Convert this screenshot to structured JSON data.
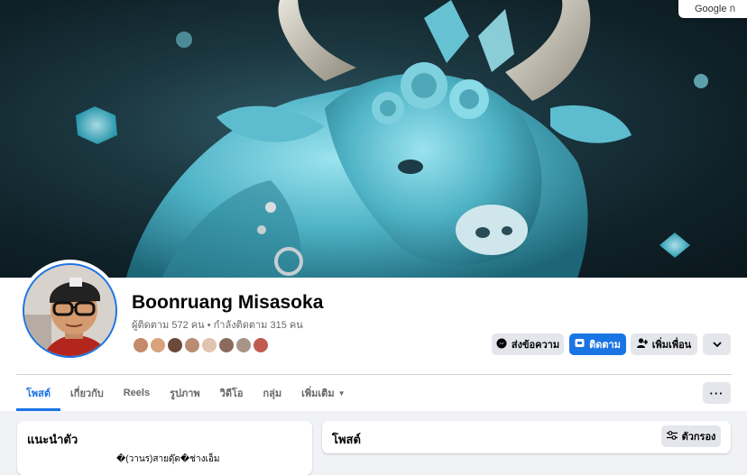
{
  "popup": {
    "text": "Google ก"
  },
  "profile": {
    "name": "Boonruang Misasoka",
    "follow_stats": "ผู้ติดตาม 572 คน • กำลังติดตาม 315 คน"
  },
  "mutual_friend_colors": [
    "#c48a6a",
    "#d9a27c",
    "#6b4a3a",
    "#b98c74",
    "#e2c3b0",
    "#8b6b5c",
    "#a89486",
    "#c25b4f"
  ],
  "actions": {
    "message_label": "ส่งข้อความ",
    "follow_label": "ติดตาม",
    "add_friend_label": "เพิ่มเพื่อน"
  },
  "tabs": [
    {
      "label": "โพสต์",
      "active": true
    },
    {
      "label": "เกี่ยวกับ",
      "active": false
    },
    {
      "label": "Reels",
      "active": false
    },
    {
      "label": "รูปภาพ",
      "active": false
    },
    {
      "label": "วิดีโอ",
      "active": false
    },
    {
      "label": "กลุ่ม",
      "active": false
    },
    {
      "label": "เพิ่มเติม",
      "active": false
    }
  ],
  "intro": {
    "title": "แนะนำตัว",
    "text": "�(วานร)สายดุ๊ด�ช่างเอ็ม"
  },
  "posts": {
    "title": "โพสต์",
    "filter_label": "ตัวกรอง"
  },
  "colors": {
    "accent": "#1b74e4",
    "page_bg": "#f0f2f5"
  }
}
